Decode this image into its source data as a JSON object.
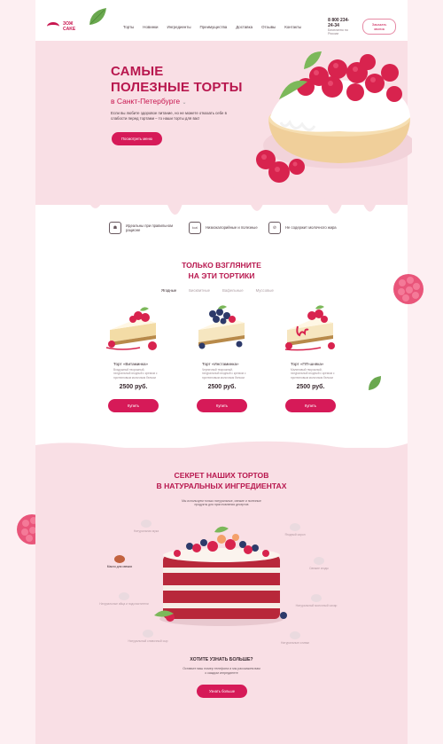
{
  "brand": {
    "logo_text": "ЗОЖ CAKE"
  },
  "nav": [
    "Торты",
    "Новинки",
    "Ингредиенты",
    "Преимущества",
    "Доставка",
    "Отзывы",
    "Контакты"
  ],
  "contact": {
    "phone": "8 800 234-24-34",
    "note": "Бесплатно по России",
    "callback": "Заказать звонок"
  },
  "hero": {
    "title_line1": "САМЫЕ",
    "title_line2": "ПОЛЕЗНЫЕ ТОРТЫ",
    "city": "в Санкт-Петербурге",
    "description": "Если вы любите здоровое питание, но не можете отказать себе в слабости перед тортами – то наши торты для вас!",
    "button": "Посмотреть меню"
  },
  "features": [
    {
      "text": "Идеальны при правильном рационе",
      "icon": "chef-hat-icon"
    },
    {
      "text": "Низкокалорийные и полезные",
      "icon": "kcal-icon"
    },
    {
      "text": "Не содержит молочного жира",
      "icon": "no-milk-icon"
    }
  ],
  "products_section": {
    "title_line1": "ТОЛЬКО ВЗГЛЯНИТЕ",
    "title_line2": "НА ЭТИ ТОРТИКИ",
    "tabs": [
      "Ягодные",
      "Бисквитные",
      "Вафельные",
      "Муссовые"
    ],
    "active_tab": 0,
    "buy_label": "Купить",
    "items": [
      {
        "name": "Торт «Витаминка»",
        "description": "Воздушный творожный, натуральный ягодный с кремом с протеиновым молочным белком",
        "price": "2500 руб."
      },
      {
        "name": "Торт «Инстаминка»",
        "description": "Черничный творожный, натуральный ягодный с кремом с протеиновым молочным белком",
        "price": "2500 руб."
      },
      {
        "name": "Торт «ПП-шняка»",
        "description": "Малиновый творожный, натуральный ягодный с кремом с протеиновым молочным белком",
        "price": "2500 руб."
      }
    ]
  },
  "secret_section": {
    "title_line1": "СЕКРЕТ НАШИХ ТОРТОВ",
    "title_line2": "В НАТУРАЛЬНЫХ ИНГРЕДИЕНТАХ",
    "subtitle": "Мы используем только натуральные, свежие и полезные продукты для приготовления десертов",
    "ingredients_left": [
      "Натуральная мука",
      "Масло для свежих",
      "Натуральные яйца и подсластители",
      "Натуральный сливочный сыр"
    ],
    "ingredients_right": [
      "Ягодный сироп",
      "Свежие ягоды",
      "Натуральный молочный сахар",
      "Натуральные сливки"
    ],
    "more_title": "ХОТИТЕ УЗНАТЬ БОЛЬШЕ?",
    "more_description": "Оставьте ваш номер телефона и мы расскажем вам о каждом ингредиенте",
    "more_button": "Узнать больше"
  },
  "colors": {
    "accent": "#d61a58",
    "title": "#b8174e",
    "pink_bg": "#f9dfe5"
  }
}
